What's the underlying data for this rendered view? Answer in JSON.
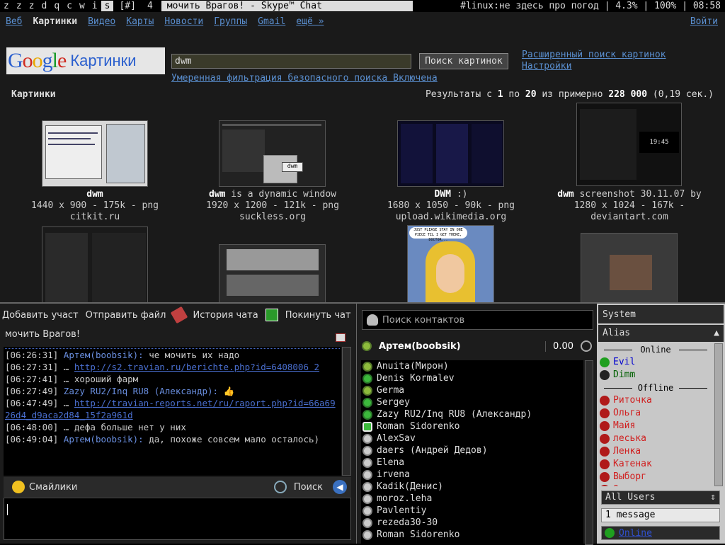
{
  "topbar": {
    "tags": [
      "z",
      "z",
      "z",
      "d",
      "q",
      "c",
      "w",
      "i",
      "s"
    ],
    "selected_tag": "s",
    "layout": "[#]",
    "client_count": "4",
    "window_title": "мочить Врагов! - Skype™ Chat",
    "status": "#linux:не здесь про погод | 4.3% | 100% | 08:58"
  },
  "google": {
    "nav": [
      "Веб",
      "Картинки",
      "Видео",
      "Карты",
      "Новости",
      "Группы",
      "Gmail",
      "ещё »"
    ],
    "current_nav": "Картинки",
    "login": "Войти",
    "logo_text": "Google",
    "logo_sub": "Картинки",
    "query": "dwm",
    "search_button": "Поиск картинок",
    "advanced": "Расширенный поиск картинок",
    "settings": "Настройки",
    "safesearch": "Умеренная фильтрация безопасного поиска Включена",
    "section_label": "Картинки",
    "results_prefix": "Результаты с ",
    "results_from": "1",
    "results_to_word": " по ",
    "results_to": "20",
    "results_mid": " из примерно ",
    "results_total": "228 000",
    "results_time": " (0,19 сек.)",
    "images": [
      {
        "title_bold": "dwm",
        "title_rest": "",
        "meta": "1440 x 900 - 175k - png",
        "site": "citkit.ru"
      },
      {
        "title_bold": "dwm",
        "title_rest": " is a dynamic window",
        "meta": "1920 x 1200 - 121k - png",
        "site": "suckless.org"
      },
      {
        "title_bold": "DWM",
        "title_rest": " :)",
        "meta": "1680 x 1050 - 90k - png",
        "site": "upload.wikimedia.org"
      },
      {
        "title_bold": "dwm",
        "title_rest": " screenshot 30.11.07 by",
        "meta": "1280 x 1024 - 167k -",
        "site": "deviantart.com"
      }
    ],
    "thumb_texts": {
      "clock": "19:45",
      "dwm_label": "dwm",
      "comic_bubble": "JUST PLEASE STAY IN ONE PIECE TIL I GET THERE, DOCTOR..."
    }
  },
  "skype_chat": {
    "toolbar": [
      "Добавить участ",
      "Отправить файл",
      "История чата",
      "Покинуть чат"
    ],
    "title": "мочить Врагов!",
    "log": [
      {
        "ts": "[06:26:31]",
        "nick": "Артем(boobsik):",
        "text": " че мочить их надо",
        "link": ""
      },
      {
        "ts": "[06:27:31]",
        "nick": "",
        "text": " … ",
        "link": "http://s2.travian.ru/berichte.php?id=6408006 2"
      },
      {
        "ts": "[06:27:41]",
        "nick": "",
        "text": " … хороший фарм",
        "link": ""
      },
      {
        "ts": "[06:27:49]",
        "nick": "Zazy RU2/Inq RU8 (Александр):",
        "text": " 👍",
        "link": ""
      },
      {
        "ts": "[06:47:49]",
        "nick": "",
        "text": " … ",
        "link": "http://travian-reports.net/ru/raport.php?id=66a6926d4_d9aca2d84_15f2a961d"
      },
      {
        "ts": "[06:48:00]",
        "nick": "",
        "text": " … дефа больше нет у них",
        "link": ""
      },
      {
        "ts": "[06:49:04]",
        "nick": "Артем(boobsik):",
        "text": " да, похоже совсем мало осталось)",
        "link": ""
      }
    ],
    "smileys": "Смайлики",
    "search": "Поиск"
  },
  "contacts": {
    "search_placeholder": "Поиск контактов",
    "me": "Артем(boobsik)",
    "credit": "0.00",
    "list": [
      {
        "name": "Anuita(Мирон)",
        "status": "away"
      },
      {
        "name": "Denis Kormalev",
        "status": "on"
      },
      {
        "name": "Germa",
        "status": "away"
      },
      {
        "name": "Sergey",
        "status": "on"
      },
      {
        "name": "Zazy RU2/Inq RU8 (Александр)",
        "status": "on"
      },
      {
        "name": "Roman Sidorenko",
        "status": "mob"
      },
      {
        "name": "AlexSav",
        "status": "off"
      },
      {
        "name": "daers (Андрей Дедов)",
        "status": "off"
      },
      {
        "name": "Elena",
        "status": "off"
      },
      {
        "name": "irvena",
        "status": "off"
      },
      {
        "name": "Kadik(Денис)",
        "status": "off"
      },
      {
        "name": "moroz.leha",
        "status": "off"
      },
      {
        "name": "Pavlentiy",
        "status": "off"
      },
      {
        "name": "rezeda30-30",
        "status": "off"
      },
      {
        "name": "Roman Sidorenko",
        "status": "off"
      }
    ]
  },
  "im_panel": {
    "system": "System",
    "alias": "Alias",
    "online_header": "Online",
    "offline_header": "Offline",
    "online": [
      {
        "name": "Evil",
        "cls": "on",
        "flower": "g"
      },
      {
        "name": "Dimm",
        "cls": "dim",
        "flower": "d"
      }
    ],
    "offline": [
      "Риточка",
      "Ольга",
      "Майя",
      "леська",
      "Ленка",
      "Катенак",
      "Выборг",
      "Оксана"
    ],
    "users_select": "All Users",
    "message_count": "1 message",
    "status": "Online"
  },
  "colors": {
    "link": "#5a8fd0",
    "nick": "#6a8fe0",
    "offline_red": "#d02020"
  }
}
